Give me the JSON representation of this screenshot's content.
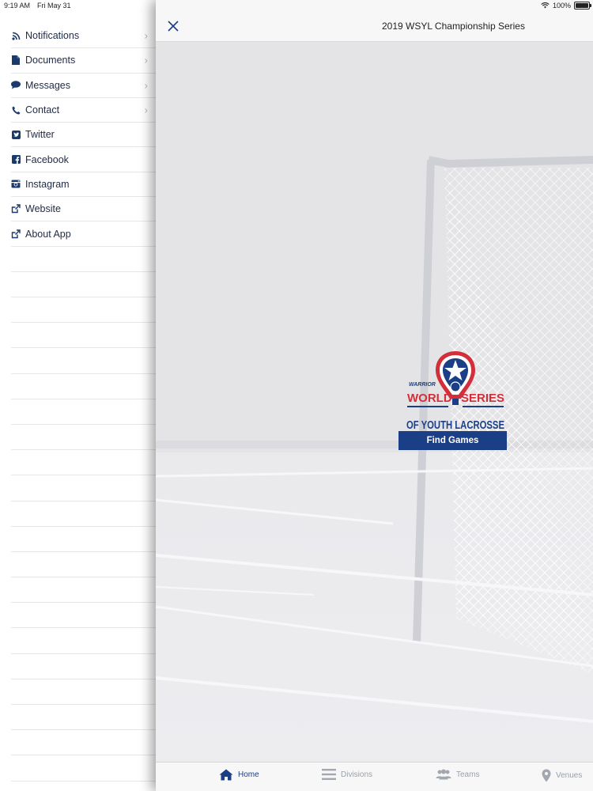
{
  "status": {
    "time": "9:19 AM",
    "date": "Fri May 31",
    "battery": "100%"
  },
  "sidebar": {
    "items": [
      {
        "label": "Notifications",
        "icon": "rss-icon",
        "chevron": true
      },
      {
        "label": "Documents",
        "icon": "document-icon",
        "chevron": true
      },
      {
        "label": "Messages",
        "icon": "chat-bubble-icon",
        "chevron": true
      },
      {
        "label": "Contact",
        "icon": "phone-icon",
        "chevron": true
      },
      {
        "label": "Twitter",
        "icon": "twitter-icon",
        "chevron": false
      },
      {
        "label": "Facebook",
        "icon": "facebook-icon",
        "chevron": false
      },
      {
        "label": "Instagram",
        "icon": "instagram-icon",
        "chevron": false
      },
      {
        "label": "Website",
        "icon": "external-link-icon",
        "chevron": false
      },
      {
        "label": "About App",
        "icon": "external-link-icon",
        "chevron": false
      }
    ]
  },
  "header": {
    "title": "2019 WSYL Championship Series"
  },
  "hero": {
    "logo_lines": [
      "WARRIOR",
      "WORLD",
      "SERIES",
      "OF YOUTH LACROSSE"
    ],
    "button_label": "Find Games"
  },
  "tabs": [
    {
      "label": "Home",
      "icon": "home-icon",
      "active": true
    },
    {
      "label": "Divisions",
      "icon": "list-icon",
      "active": false
    },
    {
      "label": "Teams",
      "icon": "people-icon",
      "active": false
    },
    {
      "label": "Venues",
      "icon": "map-pin-icon",
      "active": false
    }
  ],
  "colors": {
    "brand_blue": "#1b3f87",
    "brand_red": "#d32f3a",
    "icon_blue": "#1a3a6b"
  }
}
